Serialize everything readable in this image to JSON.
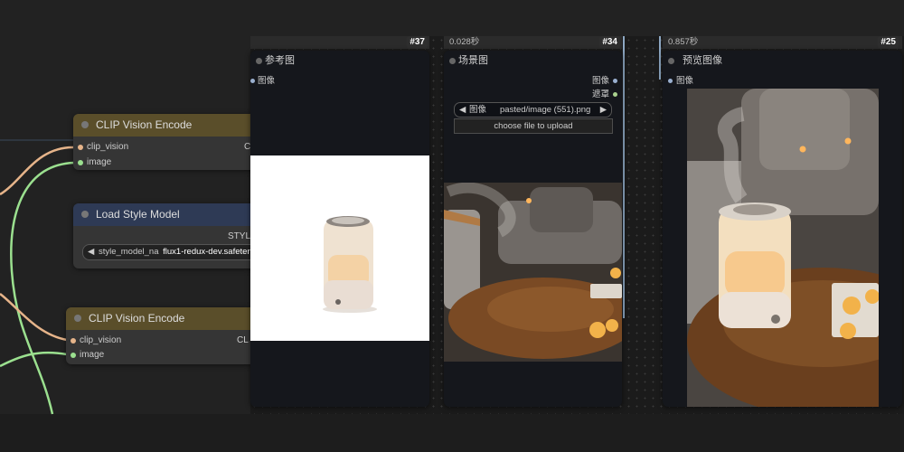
{
  "nodes": {
    "clip_vision_encode_1": {
      "title": "CLIP Vision Encode",
      "inputs": [
        "clip_vision",
        "image"
      ],
      "output": "CL"
    },
    "load_style_model": {
      "title": "Load Style Model",
      "output": "STYL",
      "widget_label": "style_model_na",
      "widget_value": "flux1-redux-dev.safeten"
    },
    "clip_vision_encode_2": {
      "title": "CLIP Vision Encode",
      "inputs": [
        "clip_vision",
        "image"
      ],
      "output": "CL"
    }
  },
  "panels": {
    "reference": {
      "badge": "#37",
      "title": "参考图",
      "output_label": "图像"
    },
    "scene": {
      "time": "0.028秒",
      "badge": "#34",
      "title": "场景图",
      "outputs": [
        "图像",
        "遮罩"
      ],
      "select_label": "图像",
      "select_value": "pasted/image (551).png",
      "upload_label": "choose file to upload"
    },
    "preview": {
      "time": "0.857秒",
      "badge": "#25",
      "title": "预览图像",
      "input_label": "图像"
    }
  },
  "icons": {
    "prev_arrow": "◀",
    "next_arrow": "▶"
  },
  "colors": {
    "wire_green": "#9be08f",
    "wire_peach": "#e6b48a",
    "clip_title_bg": "#5a4e2a",
    "style_title_bg": "#2e3a55",
    "orange_slot": "#f0a35c",
    "green_slot": "#9be08f"
  }
}
